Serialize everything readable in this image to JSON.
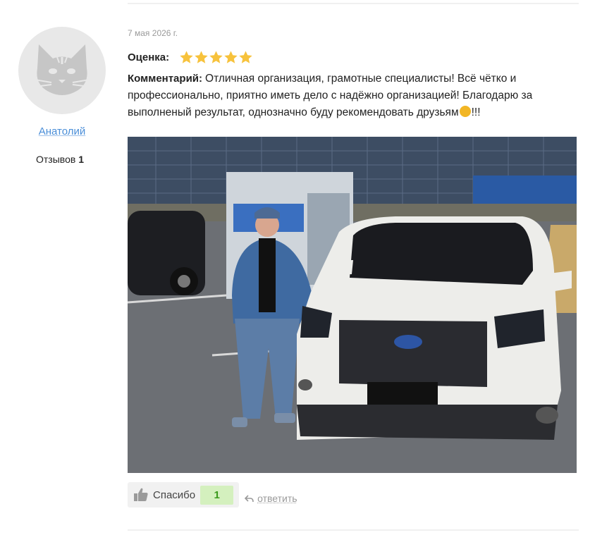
{
  "author": {
    "name": "Анатолий",
    "reviews_label": "Отзывов",
    "reviews_count": "1",
    "avatar_icon": "cat-avatar-icon"
  },
  "review": {
    "date": "7 мая 2026 г.",
    "rating_label": "Оценка:",
    "rating": 5,
    "rating_max": 5,
    "comment_label": "Комментарий:",
    "comment_text": "Отличная организация, грамотные специалисты! Всё чётко и профессионально, приятно иметь дело с надёжно организацией! Благодарю за выполненый результат, однозначно буду рекомендовать друзьям",
    "comment_emoji": "handshake-emoji",
    "comment_tail": "!!!"
  },
  "actions": {
    "thanks_label": "Спасибо",
    "thanks_count": "1",
    "reply_label": "ответить"
  },
  "colors": {
    "link": "#4a8ed8",
    "star": "#f7c23c",
    "thanks_count_bg": "#d4f0be",
    "thanks_count_text": "#3a9a1c"
  }
}
